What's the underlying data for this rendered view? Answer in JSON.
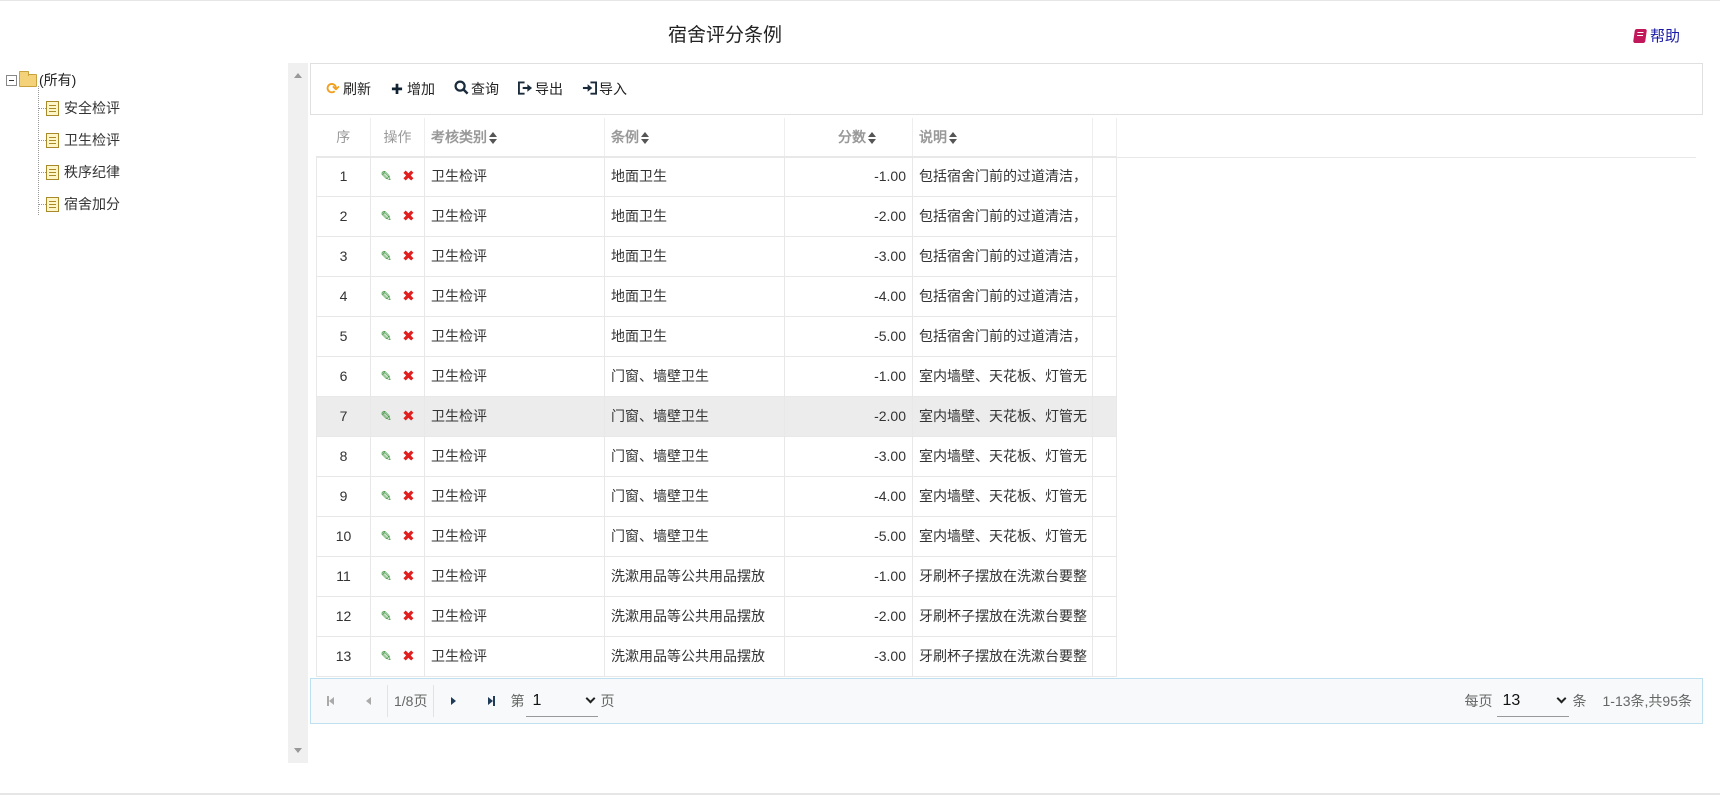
{
  "page_title": "宿舍评分条例",
  "help_label": "帮助",
  "tree": {
    "root": "(所有)",
    "items": [
      "安全检评",
      "卫生检评",
      "秩序纪律",
      "宿舍加分"
    ]
  },
  "toolbar": {
    "refresh": "刷新",
    "add": "增加",
    "query": "查询",
    "export": "导出",
    "import": "导入"
  },
  "table": {
    "columns": [
      "序",
      "操作",
      "考核类别",
      "条例",
      "分数",
      "说明"
    ],
    "rows": [
      [
        "1",
        "卫生检评",
        "地面卫生",
        "-1.00",
        "包括宿舍门前的过道清洁，"
      ],
      [
        "2",
        "卫生检评",
        "地面卫生",
        "-2.00",
        "包括宿舍门前的过道清洁，"
      ],
      [
        "3",
        "卫生检评",
        "地面卫生",
        "-3.00",
        "包括宿舍门前的过道清洁，"
      ],
      [
        "4",
        "卫生检评",
        "地面卫生",
        "-4.00",
        "包括宿舍门前的过道清洁，"
      ],
      [
        "5",
        "卫生检评",
        "地面卫生",
        "-5.00",
        "包括宿舍门前的过道清洁，"
      ],
      [
        "6",
        "卫生检评",
        "门窗、墙壁卫生",
        "-1.00",
        "室内墙壁、天花板、灯管无"
      ],
      [
        "7",
        "卫生检评",
        "门窗、墙壁卫生",
        "-2.00",
        "室内墙壁、天花板、灯管无"
      ],
      [
        "8",
        "卫生检评",
        "门窗、墙壁卫生",
        "-3.00",
        "室内墙壁、天花板、灯管无"
      ],
      [
        "9",
        "卫生检评",
        "门窗、墙壁卫生",
        "-4.00",
        "室内墙壁、天花板、灯管无"
      ],
      [
        "10",
        "卫生检评",
        "门窗、墙壁卫生",
        "-5.00",
        "室内墙壁、天花板、灯管无"
      ],
      [
        "11",
        "卫生检评",
        "洗漱用品等公共用品摆放",
        "-1.00",
        "牙刷杯子摆放在洗漱台要整"
      ],
      [
        "12",
        "卫生检评",
        "洗漱用品等公共用品摆放",
        "-2.00",
        "牙刷杯子摆放在洗漱台要整"
      ],
      [
        "13",
        "卫生检评",
        "洗漱用品等公共用品摆放",
        "-3.00",
        "牙刷杯子摆放在洗漱台要整"
      ]
    ],
    "highlighted_row": 7
  },
  "pager": {
    "page_info": "1/8页",
    "page_prefix": "第",
    "page_value": "1",
    "page_suffix": "页",
    "per_page_prefix": "每页",
    "per_page_value": "13",
    "per_page_suffix": "条",
    "total": "1-13条,共95条"
  }
}
